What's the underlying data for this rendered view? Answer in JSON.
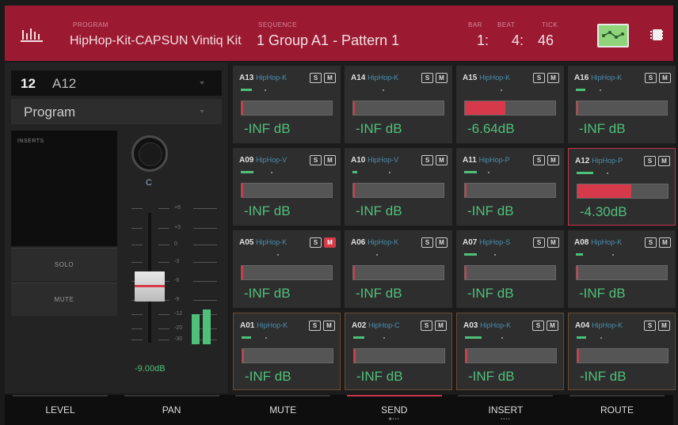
{
  "header": {
    "kit_label": "PROGRAM",
    "kit_name": "HipHop-Kit-CAPSUN Vintiq Kit",
    "sequence_label": "SEQUENCE",
    "sequence": "1  Group A1 - Pattern 1",
    "bar_label": "BAR",
    "beat_label": "BEAT",
    "tick_label": "TICK",
    "bar": "1:",
    "beat": "4:",
    "tick": "46",
    "colors": {
      "header": "#9b1a32",
      "accent_green": "#4fc07a",
      "accent_red": "#d63a4a"
    }
  },
  "channel": {
    "pad_number": "12",
    "pad_name": "A12",
    "program_type": "Program",
    "inserts_label": "INSERTS",
    "solo_label": "SOLO",
    "mute_label": "MUTE",
    "pan_value": "C",
    "fader_db": "-9.00dB",
    "scale": [
      "+6",
      "+3",
      "0",
      "-3",
      "-6",
      "-9",
      "-12",
      "-20",
      "-30"
    ]
  },
  "pads": [
    {
      "id": "A13",
      "prog": "HipHop-K",
      "db": "-INF dB",
      "level": 0,
      "mute": false,
      "selected": false,
      "meter": 0.12
    },
    {
      "id": "A14",
      "prog": "HipHop-K",
      "db": "-INF dB",
      "level": 0,
      "mute": false,
      "selected": false,
      "meter": 0
    },
    {
      "id": "A15",
      "prog": "HipHop-K",
      "db": "-6.64dB",
      "level": 0.45,
      "mute": false,
      "selected": false,
      "meter": 0
    },
    {
      "id": "A16",
      "prog": "HipHop-K",
      "db": "-INF dB",
      "level": 0,
      "mute": false,
      "selected": false,
      "meter": 0.1
    },
    {
      "id": "A09",
      "prog": "HipHop-V",
      "db": "-INF dB",
      "level": 0,
      "mute": false,
      "selected": false,
      "meter": 0.14
    },
    {
      "id": "A10",
      "prog": "HipHop-V",
      "db": "-INF dB",
      "level": 0,
      "mute": false,
      "selected": false,
      "meter": 0.05
    },
    {
      "id": "A11",
      "prog": "HipHop-P",
      "db": "-INF dB",
      "level": 0,
      "mute": false,
      "selected": false,
      "meter": 0.14
    },
    {
      "id": "A12",
      "prog": "HipHop-P",
      "db": "-4.30dB",
      "level": 0.6,
      "mute": false,
      "selected": true,
      "meter": 0.18
    },
    {
      "id": "A05",
      "prog": "HipHop-K",
      "db": "-INF dB",
      "level": 0,
      "mute": true,
      "selected": false,
      "meter": 0
    },
    {
      "id": "A06",
      "prog": "HipHop-K",
      "db": "-INF dB",
      "level": 0,
      "mute": false,
      "selected": false,
      "meter": 0
    },
    {
      "id": "A07",
      "prog": "HipHop-S",
      "db": "-INF dB",
      "level": 0,
      "mute": false,
      "selected": false,
      "meter": 0.14
    },
    {
      "id": "A08",
      "prog": "HipHop-K",
      "db": "-INF dB",
      "level": 0,
      "mute": false,
      "selected": false,
      "meter": 0.08
    },
    {
      "id": "A01",
      "prog": "HipHop-K",
      "db": "-INF dB",
      "level": 0,
      "mute": false,
      "selected": false,
      "meter": 0.1
    },
    {
      "id": "A02",
      "prog": "HipHop-C",
      "db": "-INF dB",
      "level": 0,
      "mute": false,
      "selected": false,
      "meter": 0.12
    },
    {
      "id": "A03",
      "prog": "HipHop-K",
      "db": "-INF dB",
      "level": 0,
      "mute": false,
      "selected": false,
      "meter": 0.18
    },
    {
      "id": "A04",
      "prog": "HipHop-K",
      "db": "-INF dB",
      "level": 0,
      "mute": false,
      "selected": false,
      "meter": 0.1
    }
  ],
  "solo_label": "S",
  "mute_label": "M",
  "tabs": [
    {
      "label": "LEVEL",
      "active": false,
      "dots": ""
    },
    {
      "label": "PAN",
      "active": false,
      "dots": ""
    },
    {
      "label": "MUTE",
      "active": false,
      "dots": ""
    },
    {
      "label": "SEND",
      "active": true,
      "dots": "■▪▪▪"
    },
    {
      "label": "INSERT",
      "active": false,
      "dots": "▪▪▪▪"
    },
    {
      "label": "ROUTE",
      "active": false,
      "dots": ""
    }
  ]
}
